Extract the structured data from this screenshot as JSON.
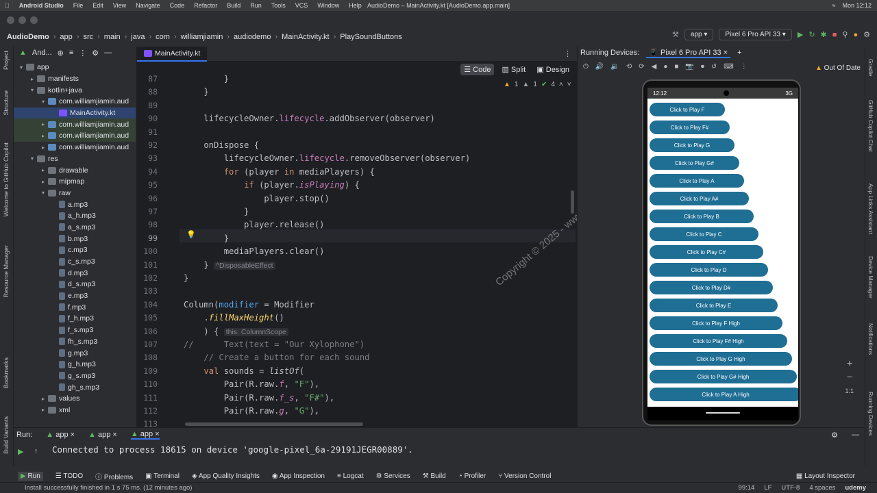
{
  "mac_menu": {
    "app": "Android Studio",
    "items": [
      "File",
      "Edit",
      "View",
      "Navigate",
      "Code",
      "Refactor",
      "Build",
      "Run",
      "Tools",
      "VCS",
      "Window",
      "Help"
    ],
    "window_title": "AudioDemo – MainActivity.kt [AudioDemo.app.main]",
    "clock": "Mon 12:12"
  },
  "breadcrumb": [
    "AudioDemo",
    "app",
    "src",
    "main",
    "java",
    "com",
    "williamjiamin",
    "audiodemo",
    "MainActivity.kt",
    "PlaySoundButtons"
  ],
  "toolbar": {
    "run_config": "app",
    "device": "Pixel 6 Pro API 33"
  },
  "project_panel": {
    "title": "And...",
    "tree": [
      {
        "label": "app",
        "depth": 0,
        "type": "folder",
        "arrow": "v"
      },
      {
        "label": "manifests",
        "depth": 1,
        "type": "folder",
        "arrow": ">"
      },
      {
        "label": "kotlin+java",
        "depth": 1,
        "type": "folder",
        "arrow": "v"
      },
      {
        "label": "com.williamjiamin.aud",
        "depth": 2,
        "type": "pkg",
        "arrow": "v"
      },
      {
        "label": "MainActivity.kt",
        "depth": 3,
        "type": "kt",
        "arrow": "",
        "selected": true
      },
      {
        "label": "com.williamjiamin.aud",
        "depth": 2,
        "type": "pkg",
        "arrow": ">",
        "hl": true
      },
      {
        "label": "com.williamjiamin.aud",
        "depth": 2,
        "type": "pkg",
        "arrow": ">",
        "hl": true
      },
      {
        "label": "com.williamjiamin.aud",
        "depth": 2,
        "type": "pkg",
        "arrow": ">"
      },
      {
        "label": "res",
        "depth": 1,
        "type": "folder",
        "arrow": "v"
      },
      {
        "label": "drawable",
        "depth": 2,
        "type": "folder",
        "arrow": ">"
      },
      {
        "label": "mipmap",
        "depth": 2,
        "type": "folder",
        "arrow": ">"
      },
      {
        "label": "raw",
        "depth": 2,
        "type": "folder",
        "arrow": "v"
      },
      {
        "label": "a.mp3",
        "depth": 3,
        "type": "mp3",
        "arrow": ""
      },
      {
        "label": "a_h.mp3",
        "depth": 3,
        "type": "mp3",
        "arrow": ""
      },
      {
        "label": "a_s.mp3",
        "depth": 3,
        "type": "mp3",
        "arrow": ""
      },
      {
        "label": "b.mp3",
        "depth": 3,
        "type": "mp3",
        "arrow": ""
      },
      {
        "label": "c.mp3",
        "depth": 3,
        "type": "mp3",
        "arrow": ""
      },
      {
        "label": "c_s.mp3",
        "depth": 3,
        "type": "mp3",
        "arrow": ""
      },
      {
        "label": "d.mp3",
        "depth": 3,
        "type": "mp3",
        "arrow": ""
      },
      {
        "label": "d_s.mp3",
        "depth": 3,
        "type": "mp3",
        "arrow": ""
      },
      {
        "label": "e.mp3",
        "depth": 3,
        "type": "mp3",
        "arrow": ""
      },
      {
        "label": "f.mp3",
        "depth": 3,
        "type": "mp3",
        "arrow": ""
      },
      {
        "label": "f_h.mp3",
        "depth": 3,
        "type": "mp3",
        "arrow": ""
      },
      {
        "label": "f_s.mp3",
        "depth": 3,
        "type": "mp3",
        "arrow": ""
      },
      {
        "label": "fh_s.mp3",
        "depth": 3,
        "type": "mp3",
        "arrow": ""
      },
      {
        "label": "g.mp3",
        "depth": 3,
        "type": "mp3",
        "arrow": ""
      },
      {
        "label": "g_h.mp3",
        "depth": 3,
        "type": "mp3",
        "arrow": ""
      },
      {
        "label": "g_s.mp3",
        "depth": 3,
        "type": "mp3",
        "arrow": ""
      },
      {
        "label": "gh_s.mp3",
        "depth": 3,
        "type": "mp3",
        "arrow": ""
      },
      {
        "label": "values",
        "depth": 2,
        "type": "folder",
        "arrow": ">"
      },
      {
        "label": "xml",
        "depth": 2,
        "type": "folder",
        "arrow": ">"
      }
    ]
  },
  "editor": {
    "tab": "MainActivity.kt",
    "view_modes": [
      "Code",
      "Split",
      "Design"
    ],
    "inspections": {
      "warn": "1",
      "weak": "1",
      "ok": "4"
    },
    "current_line": "99",
    "lines": [
      {
        "n": "87",
        "html": "        }"
      },
      {
        "n": "88",
        "html": "    }"
      },
      {
        "n": "89",
        "html": ""
      },
      {
        "n": "90",
        "html": "    lifecycleOwner.<span class='prop'>lifecycle</span>.addObserver(observer)"
      },
      {
        "n": "91",
        "html": ""
      },
      {
        "n": "92",
        "html": "    onDispose {"
      },
      {
        "n": "93",
        "html": "        lifecycleOwner.<span class='prop'>lifecycle</span>.removeObserver(observer)"
      },
      {
        "n": "94",
        "html": "        <span class='kw'>for</span> (player <span class='kw'>in</span> mediaPlayers) {"
      },
      {
        "n": "95",
        "html": "            <span class='kw'>if</span> (player.<span class='prop ital'>isPlaying</span>) {"
      },
      {
        "n": "96",
        "html": "                player.stop()"
      },
      {
        "n": "97",
        "html": "            }"
      },
      {
        "n": "98",
        "html": "            player.release()"
      },
      {
        "n": "99",
        "html": "        }"
      },
      {
        "n": "100",
        "html": "        mediaPlayers.clear()"
      },
      {
        "n": "101",
        "html": "    } <span class='hint'>^DisposableEffect</span>"
      },
      {
        "n": "102",
        "html": "}"
      },
      {
        "n": "103",
        "html": ""
      },
      {
        "n": "104",
        "html": "Column(<span class='fn'>modifier</span> = Modifier"
      },
      {
        "n": "105",
        "html": "    .<span class='ext'>fillMaxHeight</span>()"
      },
      {
        "n": "106",
        "html": "    ) { <span class='hint'>this: ColumnScope</span>"
      },
      {
        "n": "107",
        "html": "<span class='cmt'>//      Text(text = \"Our Xylophone\")</span>"
      },
      {
        "n": "108",
        "html": "    <span class='cmt'>// Create a button for each sound</span>"
      },
      {
        "n": "109",
        "html": "    <span class='kw'>val</span> sounds = <span class='ital'>listOf</span>("
      },
      {
        "n": "110",
        "html": "        Pair(R.raw.<span class='prop ital'>f</span>, <span class='str'>\"F\"</span>),"
      },
      {
        "n": "111",
        "html": "        Pair(R.raw.<span class='prop ital'>f_s</span>, <span class='str'>\"F#\"</span>),"
      },
      {
        "n": "112",
        "html": "        Pair(R.raw.<span class='prop ital'>g</span>, <span class='str'>\"G\"</span>),"
      },
      {
        "n": "113",
        "html": ""
      }
    ],
    "watermark": "Copyright © 2025 - www.p30download.com"
  },
  "running_devices": {
    "title": "Running Devices:",
    "device_tab": "Pixel 6 Pro API 33",
    "out_of_date": "Out Of Date",
    "phone_time": "12:12",
    "phone_net": "3G",
    "buttons": [
      "Click to Play F",
      "Click to Play F#",
      "Click to Play G",
      "Click to Play G#",
      "Click to Play A",
      "Click to Play A#",
      "Click to Play B",
      "Click to Play C",
      "Click to Play C#",
      "Click to Play D",
      "Click to Play D#",
      "Click to Play E",
      "Click to Play F High",
      "Click to Play F# High",
      "Click to Play G High",
      "Click to Play G# High",
      "Click to Play A High"
    ],
    "zoom": "1:1"
  },
  "run_panel": {
    "label": "Run:",
    "tabs": [
      "app",
      "app",
      "app"
    ],
    "console": "Connected to process 18615 on device 'google-pixel_6a-29191JEGR00889'."
  },
  "tool_windows": [
    "Run",
    "TODO",
    "Problems",
    "Terminal",
    "App Quality Insights",
    "App Inspection",
    "Logcat",
    "Services",
    "Build",
    "Profiler",
    "Version Control"
  ],
  "layout_inspector": "Layout Inspector",
  "status": {
    "message": "Install successfully finished in 1 s 75 ms. (12 minutes ago)",
    "position": "99:14",
    "line_sep": "LF",
    "encoding": "UTF-8",
    "indent": "4 spaces",
    "brand": "udemy"
  },
  "left_strip": [
    "Project",
    "Structure",
    "Welcome to GitHub Copilot",
    "Resource Manager",
    "Bookmarks",
    "Build Variants"
  ],
  "right_strip": [
    "Gradle",
    "GitHub Copilot Chat",
    "App Links Assistant",
    "Device Manager",
    "Notifications",
    "Running Devices"
  ]
}
